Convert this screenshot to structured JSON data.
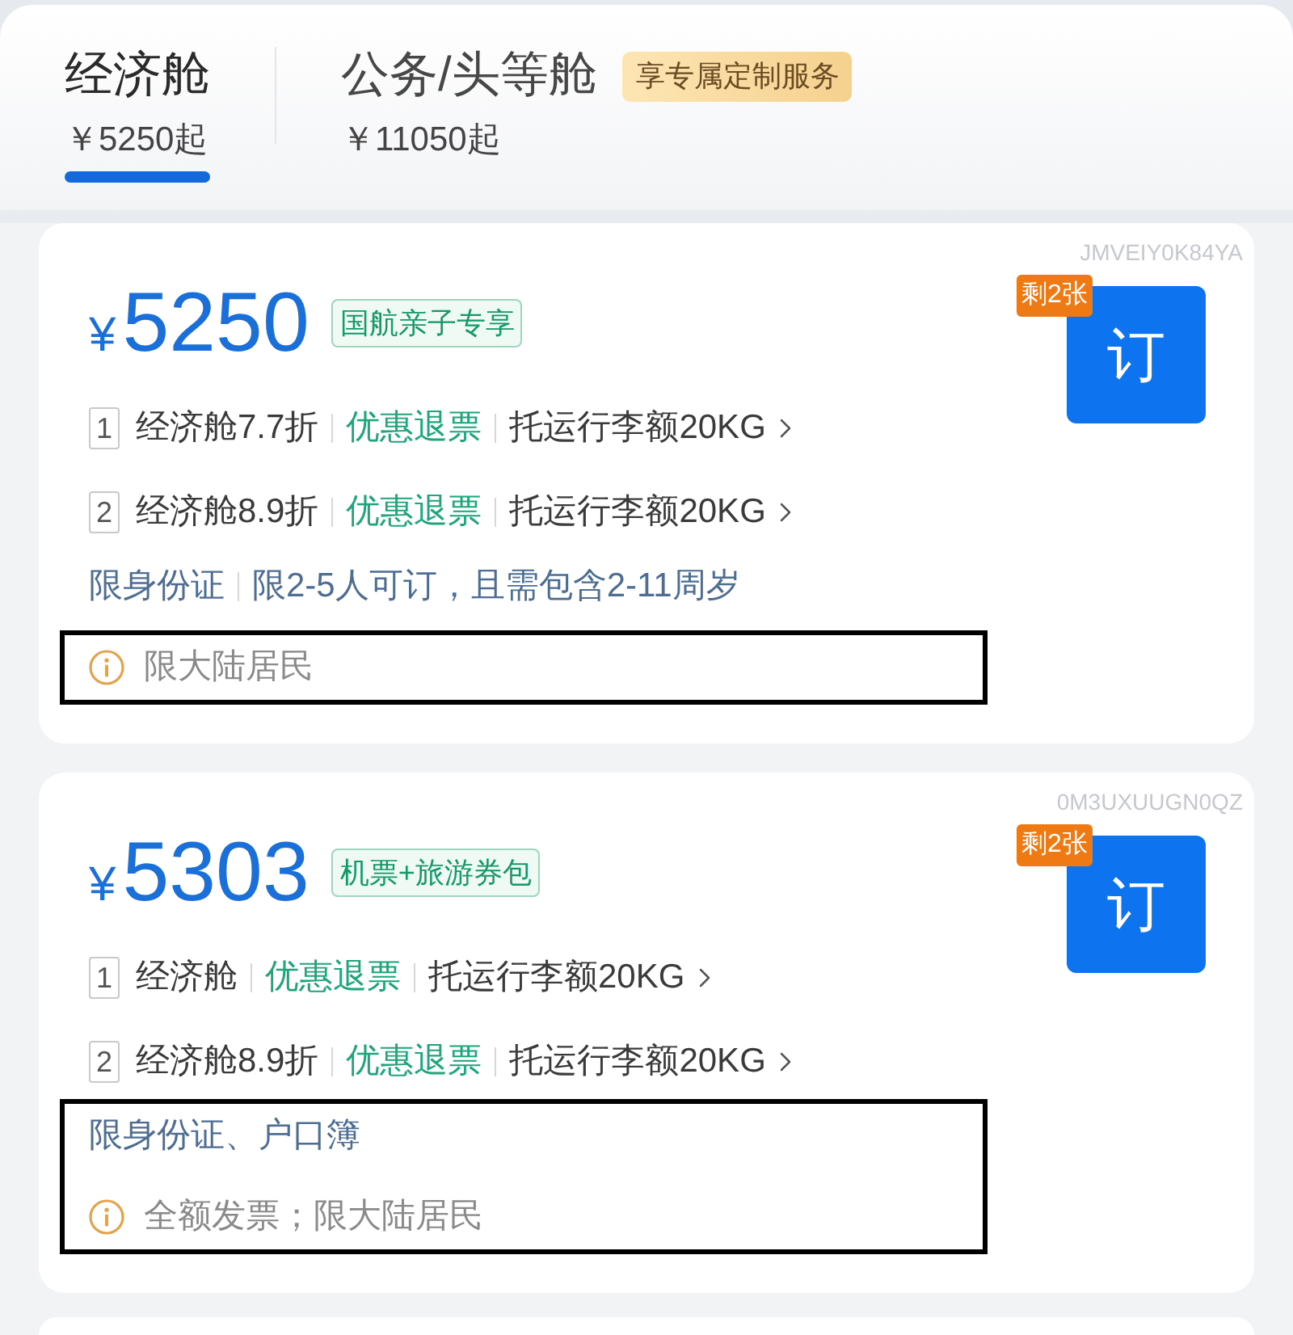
{
  "cabin_tabs": [
    {
      "label": "经济舱",
      "price": "￥5250起",
      "selected": true
    },
    {
      "label": "公务/头等舱",
      "badge": "享专属定制服务",
      "price": "￥11050起",
      "selected": false
    }
  ],
  "offers": [
    {
      "currency": "¥",
      "price": "5250",
      "tag": "国航亲子专享",
      "code": "JMVEIY0K84YA",
      "remaining": "剩2张",
      "book_label": "订",
      "segments": [
        {
          "number": "1",
          "cabin": "经济舱7.7折",
          "refund": "优惠退票",
          "baggage": "托运行李额20KG"
        },
        {
          "number": "2",
          "cabin": "经济舱8.9折",
          "refund": "优惠退票",
          "baggage": "托运行李额20KG"
        }
      ],
      "footer_lines": [
        {
          "kind": "restriction",
          "parts": [
            "限身份证",
            "限2-5人可订，且需包含2-11周岁"
          ],
          "highlighted": false
        },
        {
          "kind": "notice",
          "text": "限大陆居民",
          "highlighted": true
        }
      ]
    },
    {
      "currency": "¥",
      "price": "5303",
      "tag": "机票+旅游券包",
      "code": "0M3UXUUGN0QZ",
      "remaining": "剩2张",
      "book_label": "订",
      "segments": [
        {
          "number": "1",
          "cabin": "经济舱",
          "refund": "优惠退票",
          "baggage": "托运行李额20KG"
        },
        {
          "number": "2",
          "cabin": "经济舱8.9折",
          "refund": "优惠退票",
          "baggage": "托运行李额20KG"
        }
      ],
      "footer_lines": [
        {
          "kind": "restriction",
          "parts": [
            "限身份证、户口簿"
          ],
          "highlighted": true
        },
        {
          "kind": "notice",
          "text": "全额发票；限大陆居民",
          "highlighted": true
        }
      ]
    }
  ]
}
